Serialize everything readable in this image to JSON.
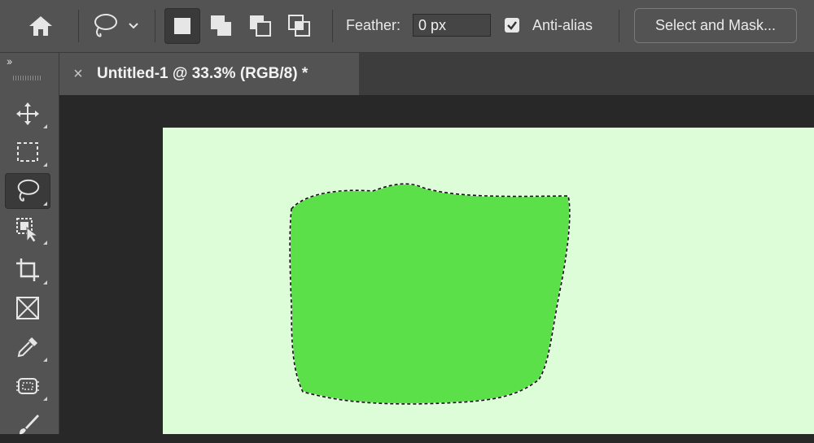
{
  "options_bar": {
    "feather_label": "Feather:",
    "feather_value": "0 px",
    "antialias_label": "Anti-alias",
    "antialias_checked": true,
    "select_mask_label": "Select and Mask..."
  },
  "document": {
    "tab_title": "Untitled-1 @ 33.3% (RGB/8) *",
    "close_glyph": "×"
  },
  "toolbar": {
    "collapse_glyph": "››",
    "tools": [
      "move-icon",
      "marquee-icon",
      "lasso-icon",
      "object-select-icon",
      "crop-icon",
      "frame-icon",
      "eyedropper-icon",
      "patch-icon",
      "brush-icon"
    ],
    "active_tool": "lasso-icon"
  },
  "colors": {
    "ui_panel": "#535353",
    "ui_dark": "#282828",
    "canvas_bg": "#ddfdd8",
    "shape_fill": "#5ce04a"
  }
}
